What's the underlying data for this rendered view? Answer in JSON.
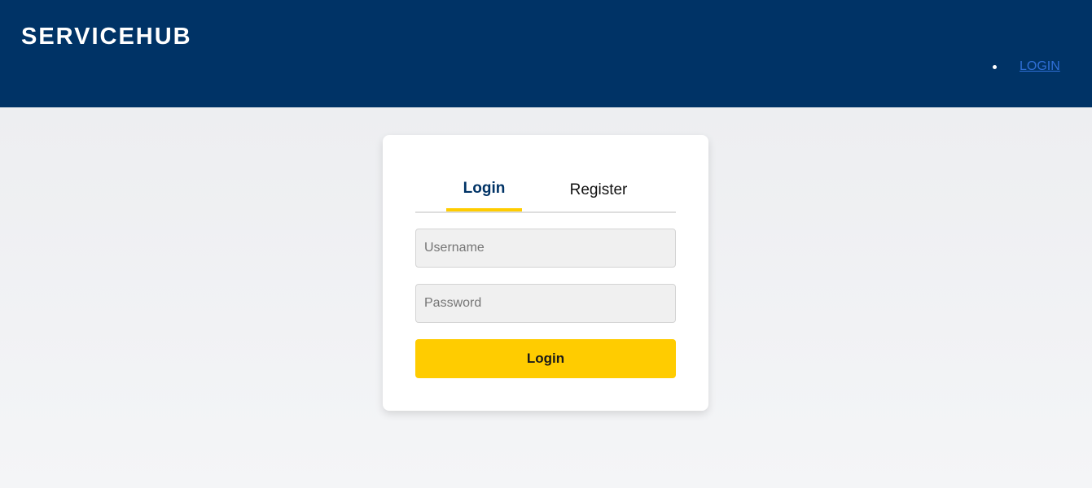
{
  "header": {
    "brand": "SERVICEHUB",
    "nav": [
      {
        "label": "LOGIN"
      }
    ]
  },
  "auth": {
    "tabs": [
      {
        "label": "Login",
        "active": true
      },
      {
        "label": "Register",
        "active": false
      }
    ],
    "username_placeholder": "Username",
    "password_placeholder": "Password",
    "submit_label": "Login"
  },
  "colors": {
    "header_bg": "#003366",
    "accent": "#ffcc00",
    "link": "#2f6fd6"
  }
}
